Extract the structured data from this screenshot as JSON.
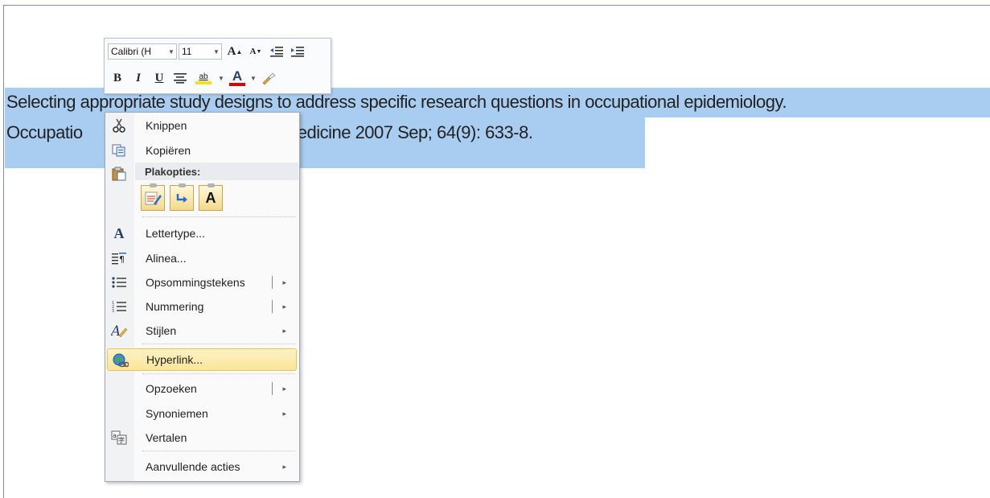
{
  "document": {
    "line1": "Selecting appropriate study designs to address specific research questions in occupational epidemiology.",
    "line2_left": "Occupatio",
    "line2_right": "tal medicine 2007 Sep; 64(9): 633-8."
  },
  "mini_toolbar": {
    "font_name": "Calibri (H",
    "font_size": "11",
    "grow_font": "A",
    "shrink_font": "A",
    "bold": "B",
    "italic": "I",
    "underline": "U",
    "font_color_letter": "A",
    "highlight_text": "ab",
    "highlight_color": "#f5e020",
    "font_color": "#e00000"
  },
  "context_menu": {
    "items": [
      {
        "label": "Knippen",
        "icon": "scissors-icon"
      },
      {
        "label": "Kopiëren",
        "icon": "copy-icon"
      },
      {
        "label": "Lettertype...",
        "icon": "font-icon"
      },
      {
        "label": "Alinea...",
        "icon": "paragraph-icon"
      },
      {
        "label": "Opsommingstekens",
        "icon": "bullets-icon",
        "submenu": true
      },
      {
        "label": "Nummering",
        "icon": "numbering-icon",
        "submenu": true
      },
      {
        "label": "Stijlen",
        "icon": "styles-icon",
        "submenu": true
      },
      {
        "label": "Hyperlink...",
        "icon": "hyperlink-icon",
        "highlighted": true
      },
      {
        "label": "Opzoeken",
        "icon": "",
        "submenu": true
      },
      {
        "label": "Synoniemen",
        "icon": "",
        "submenu": true
      },
      {
        "label": "Vertalen",
        "icon": "translate-icon"
      },
      {
        "label": "Aanvullende acties",
        "icon": "",
        "submenu": true
      }
    ],
    "paste_header": "Plakopties:",
    "paste_icon": "paste-icon",
    "paste_options": [
      "keep-source-formatting-icon",
      "merge-formatting-icon",
      "keep-text-only-icon"
    ],
    "paste_text_only_letter": "A",
    "submenu_arrow": "▸",
    "highlight_color": "#fbe59a"
  },
  "colors": {
    "selection": "#a9cdf0"
  }
}
